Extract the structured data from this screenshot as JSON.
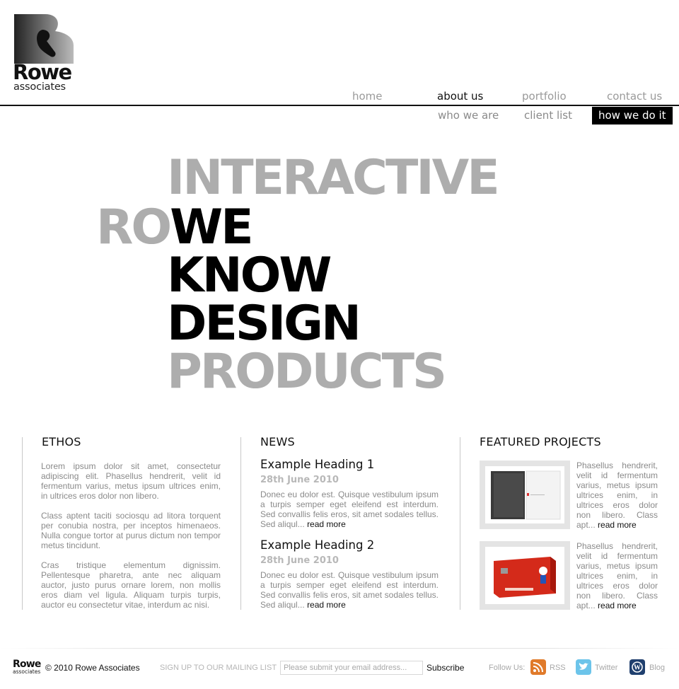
{
  "brand": {
    "name": "Rowe",
    "sub": "associates"
  },
  "nav": {
    "items": [
      {
        "label": "home",
        "active": false
      },
      {
        "label": "about us",
        "active": true
      },
      {
        "label": "portfolio",
        "active": false
      },
      {
        "label": "contact us",
        "active": false
      }
    ],
    "sub_items": [
      {
        "label": "who we are",
        "active": false
      },
      {
        "label": "client list",
        "active": false
      },
      {
        "label": "how we do it",
        "active": true
      }
    ]
  },
  "hero": {
    "line1": "INTERACTIVE",
    "line2_grey": "RO",
    "line2_black": "WE",
    "line3": "KNOW",
    "line4": "DESIGN",
    "line5": "PRODUCTS"
  },
  "ethos": {
    "title": "ETHOS",
    "paragraphs": [
      "Lorem ipsum dolor sit amet, consectetur adipiscing elit. Phasellus hendrerit, velit id fermentum varius, metus ipsum ultrices enim, in ultrices eros dolor non libero.",
      "Class aptent taciti sociosqu ad litora torquent per conubia nostra, per inceptos himenaeos. Nulla congue tortor at purus dictum non tempor metus tincidunt.",
      "Cras tristique elementum dignissim. Pellentesque pharetra, ante nec aliquam auctor, justo purus ornare lorem, non mollis eros diam vel ligula. Aliquam turpis turpis, auctor eu consectetur vitae, interdum ac nisi."
    ]
  },
  "news": {
    "title": "NEWS",
    "items": [
      {
        "heading": "Example Heading 1",
        "date": "28th June 2010",
        "text": "Donec eu dolor est. Quisque vestibulum ipsum a turpis semper eget eleifend est interdum. Sed convallis felis eros, sit amet sodales tellus. Sed aliqul...",
        "more": "read more"
      },
      {
        "heading": "Example Heading 2",
        "date": "28th June 2010",
        "text": "Donec eu dolor est. Quisque vestibulum ipsum a turpis semper eget eleifend est interdum. Sed convallis felis eros, sit amet sodales tellus. Sed aliqul...",
        "more": "read more"
      }
    ]
  },
  "featured": {
    "title": "FEATURED PROJECTS",
    "items": [
      {
        "text": "Phasellus hendrerit, velit id fermentum varius, metus ipsum ultrices enim, in ultrices eros dolor non libero. Class apt...",
        "more": "read more"
      },
      {
        "text": "Phasellus hendrerit, velit id fermentum varius, metus ipsum ultrices enim, in ultrices eros dolor non libero. Class apt...",
        "more": "read more"
      }
    ]
  },
  "footer": {
    "logo_name": "Rowe",
    "logo_sub": "associates",
    "copyright": "© 2010 Rowe Associates",
    "signup_label": "SIGN UP TO OUR MAILING LIST",
    "email_placeholder": "Please submit your email address...",
    "subscribe_label": "Subscribe",
    "follow_label": "Follow Us:",
    "social": [
      {
        "label": "RSS",
        "icon": "rss-icon",
        "color": "#e07a2a"
      },
      {
        "label": "Twitter",
        "icon": "twitter-icon",
        "color": "#5ab9e6"
      },
      {
        "label": "Blog",
        "icon": "wordpress-icon",
        "color": "#1f3f6e"
      }
    ]
  }
}
